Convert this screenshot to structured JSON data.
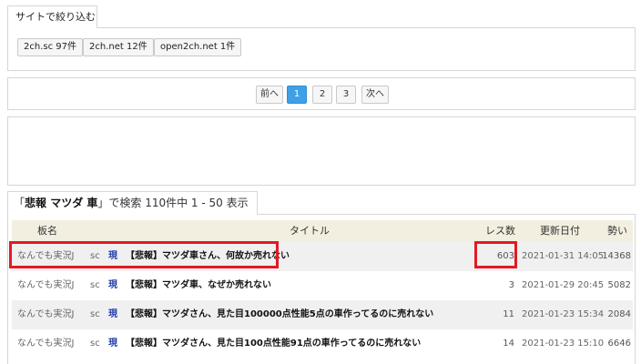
{
  "site_filter": {
    "tab_label": "サイトで絞り込む",
    "chips": [
      "2ch.sc 97件",
      "2ch.net 12件",
      "open2ch.net 1件"
    ]
  },
  "pagination": {
    "prev": "前へ",
    "pages": [
      "1",
      "2",
      "3"
    ],
    "current": "1",
    "next": "次へ"
  },
  "search": {
    "open_quote": "「",
    "query": "悲報 マツダ 車",
    "close_quote": "」",
    "summary": "で検索 110件中 1 - 50 表示"
  },
  "table": {
    "headers": {
      "board": "板名",
      "title": "タイトル",
      "res": "レス数",
      "date": "更新日付",
      "momentum": "勢い"
    },
    "rows": [
      {
        "board": "なんでも実況J",
        "site": "sc",
        "current": "現",
        "title": "【悲報】マツダ車さん、何故か売れない",
        "res": "603",
        "date": "2021-01-31 14:05",
        "momentum": "14368"
      },
      {
        "board": "なんでも実況J",
        "site": "sc",
        "current": "現",
        "title": "【悲報】マツダ車、なぜか売れない",
        "res": "3",
        "date": "2021-01-29 20:45",
        "momentum": "5082"
      },
      {
        "board": "なんでも実況J",
        "site": "sc",
        "current": "現",
        "title": "【悲報】マツダさん、見た目100000点性能5点の車作ってるのに売れない",
        "res": "11",
        "date": "2021-01-23 15:34",
        "momentum": "2084"
      },
      {
        "board": "なんでも実況J",
        "site": "sc",
        "current": "現",
        "title": "【悲報】マツダさん、見た目100点性能91点の車作ってるのに売れない",
        "res": "14",
        "date": "2021-01-23 15:10",
        "momentum": "6646"
      }
    ]
  },
  "colors": {
    "highlight": "#e01b24",
    "active_page": "#3ea0e6",
    "header_bg": "#f3efe0",
    "current_mark": "#1e3aa8"
  }
}
